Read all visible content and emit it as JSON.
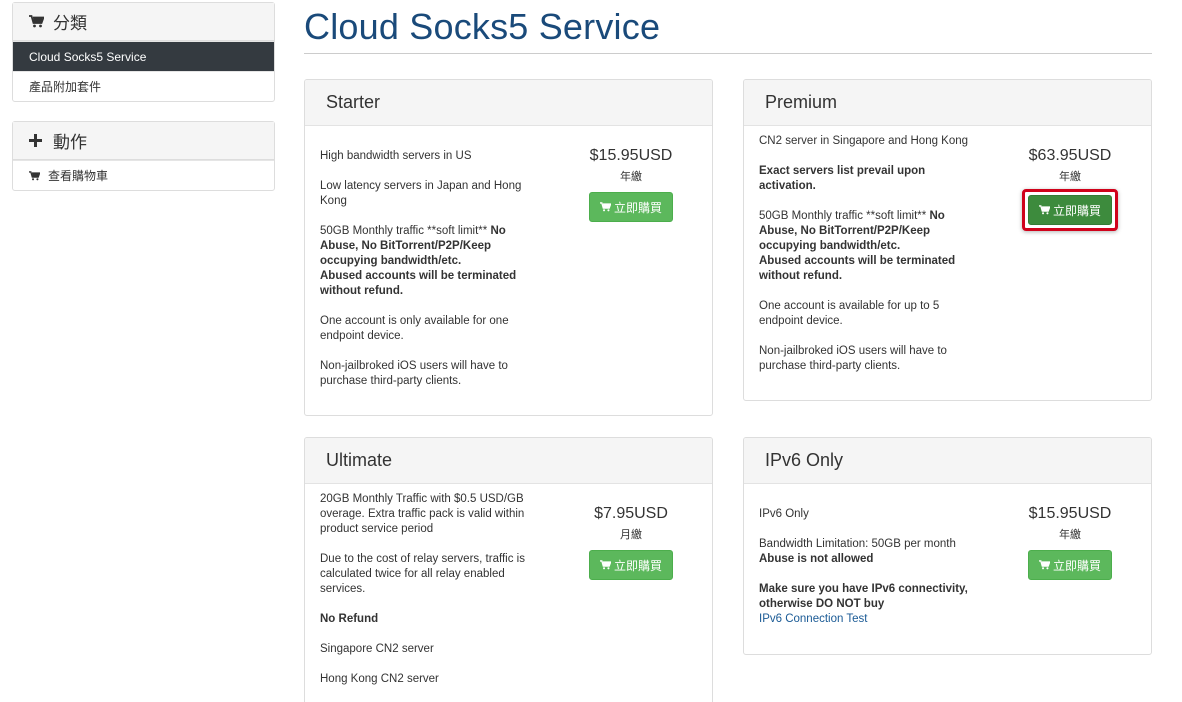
{
  "sidebar": {
    "categories": {
      "title": "分類",
      "items": [
        {
          "label": "Cloud Socks5 Service"
        },
        {
          "label": "產品附加套件"
        }
      ]
    },
    "actions": {
      "title": "動作",
      "items": [
        {
          "label": "查看購物車"
        }
      ]
    }
  },
  "page": {
    "title": "Cloud Socks5 Service"
  },
  "buy_label": "立即購買",
  "products": [
    {
      "name": "Starter",
      "price": "$15.95USD",
      "cycle": "年繳",
      "desc": [
        "High bandwidth servers in US",
        "Low latency servers in Japan and Hong Kong",
        "50GB Monthly traffic **soft limit** ",
        "No Abuse, No BitTorrent/P2P/Keep occupying bandwidth/etc.",
        "Abused accounts will be terminated without refund.",
        "One account is only available for one endpoint device.",
        "Non-jailbroked iOS users will have to purchase third-party clients."
      ]
    },
    {
      "name": "Premium",
      "price": "$63.95USD",
      "cycle": "年繳",
      "desc": [
        "CN2 server in Singapore and Hong Kong",
        "Exact servers list prevail upon activation.",
        "50GB Monthly traffic **soft limit** ",
        "No Abuse, No BitTorrent/P2P/Keep occupying bandwidth/etc.",
        "Abused accounts will be terminated without refund.",
        "One account is available for up to 5 endpoint device.",
        "Non-jailbroked iOS users will have to purchase third-party clients."
      ]
    },
    {
      "name": "Ultimate",
      "price": "$7.95USD",
      "cycle": "月繳",
      "desc": [
        "20GB Monthly Traffic with $0.5 USD/GB overage. Extra traffic pack is valid within product service period",
        "Due to the cost of relay servers, traffic is calculated twice for all relay enabled services.",
        "No Refund",
        "Singapore CN2 server",
        "Hong Kong CN2 server"
      ]
    },
    {
      "name": "IPv6 Only",
      "price": "$15.95USD",
      "cycle": "年繳",
      "desc": [
        "IPv6 Only",
        "Bandwidth Limitation: 50GB per month",
        "Abuse is not allowed",
        "Make sure you have IPv6 connectivity, otherwise DO NOT buy",
        "IPv6 Connection Test"
      ]
    }
  ]
}
